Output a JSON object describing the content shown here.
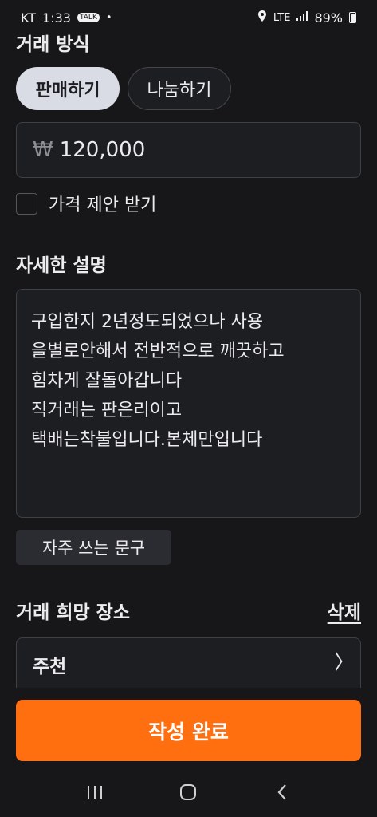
{
  "status_bar": {
    "carrier": "KT",
    "time": "1:33",
    "talk_badge": "TALK",
    "network": "LTE",
    "battery": "89%"
  },
  "trade_method": {
    "title": "거래 방식",
    "options": [
      {
        "label": "판매하기",
        "selected": true
      },
      {
        "label": "나눔하기",
        "selected": false
      }
    ]
  },
  "price": {
    "currency_symbol": "₩",
    "value": "120,000"
  },
  "price_offer": {
    "label": "가격 제안 받기",
    "checked": false
  },
  "description": {
    "title": "자세한 설명",
    "lines": [
      "구입한지 2년정도되었으나 사용",
      "을별로안해서 전반적으로 깨끗하고",
      "힘차게 잘돌아갑니다",
      "직거래는 판은리이고",
      "택배는착불입니다.본체만입니다"
    ]
  },
  "frequent_phrases": {
    "label": "자주 쓰는 문구"
  },
  "trade_place": {
    "title": "거래 희망 장소",
    "delete_label": "삭제",
    "value": "주천"
  },
  "submit": {
    "label": "작성 완료"
  },
  "colors": {
    "accent": "#ff6f0f",
    "background": "#17171a"
  }
}
